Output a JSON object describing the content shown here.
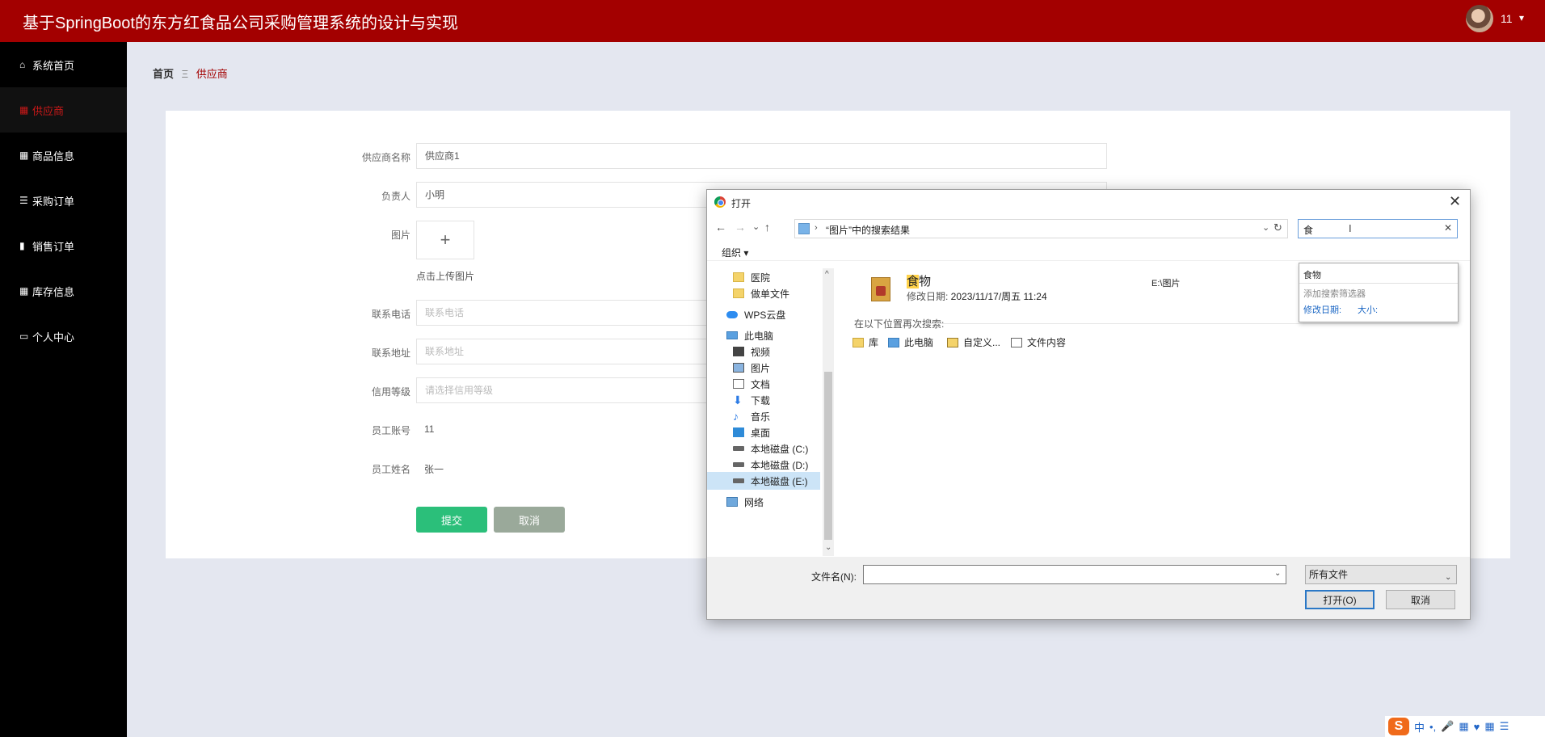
{
  "header": {
    "title": "基于SpringBoot的东方红食品公司采购管理系统的设计与实现",
    "username": "11",
    "caret": "▾"
  },
  "sidebar": {
    "items": [
      {
        "label": "系统首页",
        "icon": "home-icon",
        "glyph": "⌂"
      },
      {
        "label": "供应商",
        "icon": "supplier-icon",
        "glyph": "▦"
      },
      {
        "label": "商品信息",
        "icon": "grid-icon",
        "glyph": "▦"
      },
      {
        "label": "采购订单",
        "icon": "sliders-icon",
        "glyph": "☰"
      },
      {
        "label": "销售订单",
        "icon": "receipt-icon",
        "glyph": "▮"
      },
      {
        "label": "库存信息",
        "icon": "grid-icon",
        "glyph": "▦"
      },
      {
        "label": "个人中心",
        "icon": "user-card-icon",
        "glyph": "▭"
      }
    ]
  },
  "breadcrumb": {
    "home": "首页",
    "sep": "Ξ",
    "current": "供应商"
  },
  "form": {
    "supplier_name_label": "供应商名称",
    "supplier_name_value": "供应商1",
    "contact_label": "负责人",
    "contact_value": "小明",
    "image_label": "图片",
    "upload_plus": "+",
    "upload_hint": "点击上传图片",
    "phone_label": "联系电话",
    "phone_placeholder": "联系电话",
    "address_label": "联系地址",
    "address_placeholder": "联系地址",
    "credit_label": "信用等级",
    "credit_placeholder": "请选择信用等级",
    "emp_account_label": "员工账号",
    "emp_account_value": "11",
    "emp_name_label": "员工姓名",
    "emp_name_value": "张一",
    "submit": "提交",
    "cancel": "取消"
  },
  "dialog": {
    "title": "打开",
    "close": "✕",
    "nav": {
      "back": "←",
      "forward": "→",
      "recent": "⌄",
      "up": "↑",
      "gt": "›",
      "path": "“图片”中的搜索结果",
      "dd": "⌄",
      "refresh": "↻"
    },
    "search": {
      "value": "食",
      "cursor": "I",
      "clear": "✕"
    },
    "suggest": {
      "item": "食物",
      "add_filter": "添加搜索筛选器",
      "date": "修改日期:",
      "size": "大小:"
    },
    "toolbar": {
      "organize": "组织 ▾"
    },
    "nav_pane": [
      {
        "label": "医院",
        "icon": "folder-icon"
      },
      {
        "label": "做单文件",
        "icon": "folder-icon"
      },
      {
        "label": "WPS云盘",
        "icon": "cloud-icon"
      },
      {
        "label": "此电脑",
        "icon": "computer-icon"
      },
      {
        "label": "视频",
        "icon": "video-icon"
      },
      {
        "label": "图片",
        "icon": "pictures-icon"
      },
      {
        "label": "文档",
        "icon": "documents-icon"
      },
      {
        "label": "下载",
        "icon": "download-icon"
      },
      {
        "label": "音乐",
        "icon": "music-icon"
      },
      {
        "label": "桌面",
        "icon": "desktop-icon"
      },
      {
        "label": "本地磁盘 (C:)",
        "icon": "drive-icon"
      },
      {
        "label": "本地磁盘 (D:)",
        "icon": "drive-icon"
      },
      {
        "label": "本地磁盘 (E:)",
        "icon": "drive-icon",
        "selected": true
      },
      {
        "label": "网络",
        "icon": "network-icon"
      }
    ],
    "scroll": {
      "up": "^",
      "down": "⌄"
    },
    "result": {
      "name_hl": "食",
      "name_rest": "物",
      "meta_label": "修改日期: ",
      "meta_value": "2023/11/17/周五 11:24",
      "path": "E:\\图片"
    },
    "search_again": "在以下位置再次搜索:",
    "locations": [
      "库",
      "此电脑",
      "自定义...",
      "文件内容"
    ],
    "filename_label": "文件名(N):",
    "filename_value": "",
    "filetype": "所有文件",
    "open_btn": "打开(O)",
    "cancel_btn": "取消",
    "dd": "⌄"
  },
  "ime": {
    "logo": "S",
    "items": [
      "中",
      "•,",
      "🎤",
      "▦",
      "♥",
      "▦",
      "☰"
    ]
  }
}
